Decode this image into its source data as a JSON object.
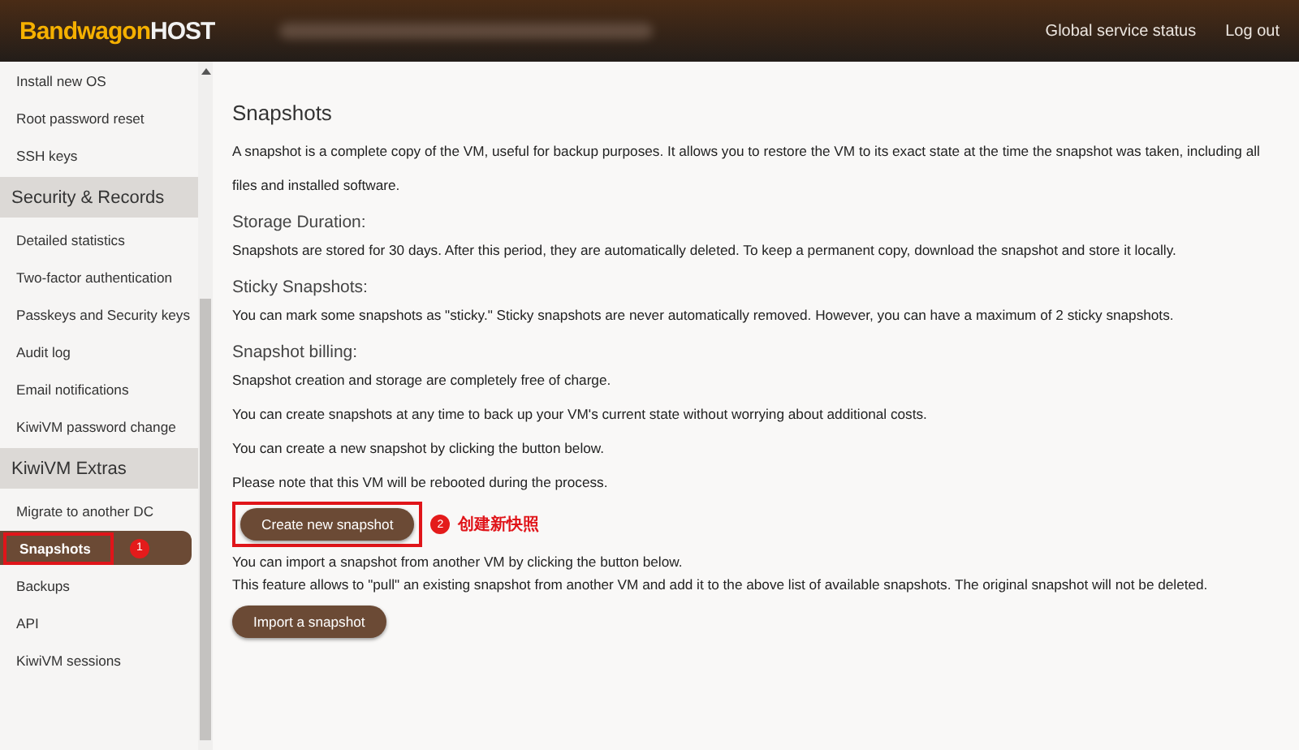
{
  "header": {
    "logo": {
      "part_1": "Bandwagon",
      "part_2": "HOST"
    },
    "links": [
      "Global service status",
      "Log out"
    ]
  },
  "sidebar": {
    "sections": [
      {
        "items": [
          {
            "label": "Install new OS",
            "selected": false
          },
          {
            "label": "Root password reset",
            "selected": false
          },
          {
            "label": "SSH keys",
            "selected": false
          }
        ]
      },
      {
        "title": "Security & Records",
        "items": [
          {
            "label": "Detailed statistics",
            "selected": false
          },
          {
            "label": "Two-factor authentication",
            "selected": false
          },
          {
            "label": "Passkeys and Security keys",
            "selected": false
          },
          {
            "label": "Audit log",
            "selected": false
          },
          {
            "label": "Email notifications",
            "selected": false
          },
          {
            "label": "KiwiVM password change",
            "selected": false
          }
        ]
      },
      {
        "title": "KiwiVM Extras",
        "items": [
          {
            "label": "Migrate to another DC",
            "selected": false
          },
          {
            "label": "Snapshots",
            "selected": true,
            "callout": {
              "number": "1"
            }
          },
          {
            "label": "Backups",
            "selected": false
          },
          {
            "label": "API",
            "selected": false
          },
          {
            "label": "KiwiVM sessions",
            "selected": false
          }
        ]
      }
    ]
  },
  "content": {
    "title": "Snapshots",
    "blocks": [
      {
        "kind": "paragraph",
        "text": "A snapshot is a complete copy of the VM, useful for backup purposes. It allows you to restore the VM to its exact state at the time the snapshot was taken, including all files and installed software."
      },
      {
        "kind": "heading",
        "text": "Storage Duration:"
      },
      {
        "kind": "paragraph",
        "text": "Snapshots are stored for 30 days. After this period, they are automatically deleted. To keep a permanent copy, download the snapshot and store it locally."
      },
      {
        "kind": "heading",
        "text": "Sticky Snapshots:"
      },
      {
        "kind": "paragraph",
        "text": "You can mark some snapshots as \"sticky.\" Sticky snapshots are never automatically removed. However, you can have a maximum of 2 sticky snapshots."
      },
      {
        "kind": "heading",
        "text": "Snapshot billing:"
      },
      {
        "kind": "paragraph",
        "text": "Snapshot creation and storage are completely free of charge."
      },
      {
        "kind": "paragraph",
        "text": "You can create snapshots at any time to back up your VM's current state without worrying about additional costs."
      },
      {
        "kind": "paragraph",
        "text": "You can create a new snapshot by clicking the button below."
      },
      {
        "kind": "paragraph",
        "text": "Please note that this VM will be rebooted during the process."
      },
      {
        "kind": "button",
        "label": "Create new snapshot",
        "callout": {
          "number": "2",
          "text": "创建新快照"
        }
      },
      {
        "kind": "note",
        "lines": [
          "You can import a snapshot from another VM by clicking the button below.",
          "This feature allows to \"pull\" an existing snapshot from another VM and add it to the above list of available snapshots. The original snapshot will not be deleted."
        ]
      },
      {
        "kind": "button",
        "label": "Import a snapshot"
      }
    ]
  }
}
